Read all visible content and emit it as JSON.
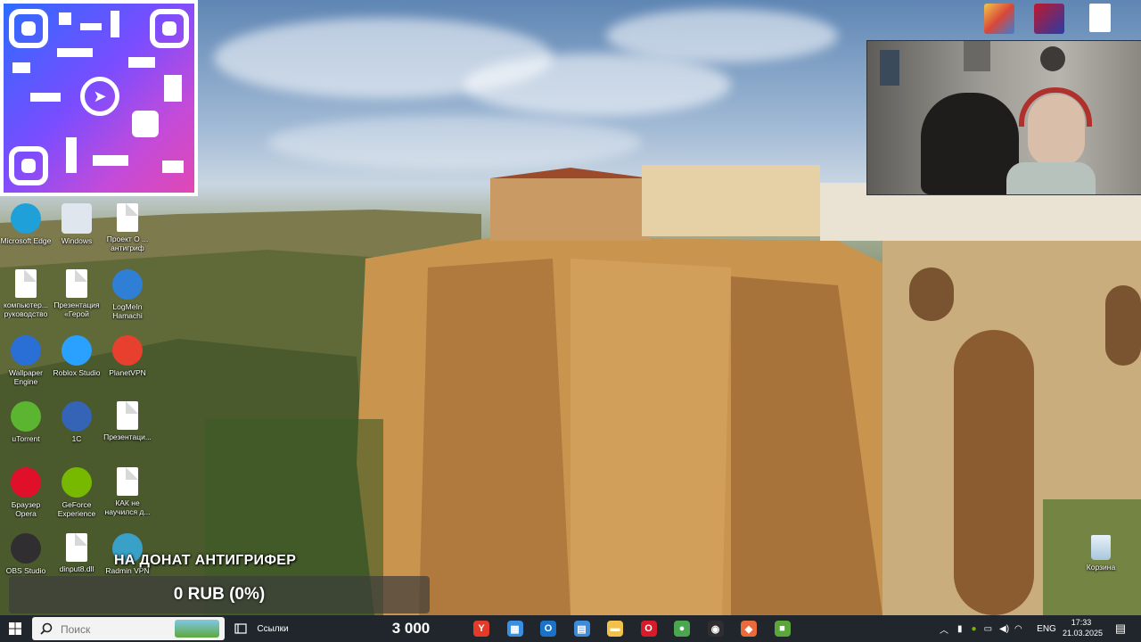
{
  "desktop": {
    "icons": [
      {
        "label": "Microsoft Edge",
        "kind": "edge",
        "color": "#1fa0d8"
      },
      {
        "label": "Windows",
        "kind": "win",
        "color": "#dfe6ee"
      },
      {
        "label": "Проект О ... антигриф",
        "kind": "doc",
        "color": "#ffffff"
      },
      {
        "label": "компьютер... руководство",
        "kind": "doc",
        "color": "#ffffff"
      },
      {
        "label": "Презентация «Герой",
        "kind": "doc",
        "color": "#ffffff"
      },
      {
        "label": "LogMeIn Hamachi",
        "kind": "app",
        "color": "#2f7fd6"
      },
      {
        "label": "Wallpaper Engine",
        "kind": "app",
        "color": "#2a6fd6"
      },
      {
        "label": "Roblox Studio",
        "kind": "app",
        "color": "#2aa0ff"
      },
      {
        "label": "PlanetVPN",
        "kind": "app",
        "color": "#e8402f"
      },
      {
        "label": "uTorrent",
        "kind": "app",
        "color": "#5cb531"
      },
      {
        "label": "1С",
        "kind": "app",
        "color": "#3563b5"
      },
      {
        "label": "Презентаци...",
        "kind": "doc",
        "color": "#ffffff"
      },
      {
        "label": "Браузер Opera",
        "kind": "app",
        "color": "#e0102a"
      },
      {
        "label": "GeForce Experience",
        "kind": "app",
        "color": "#76b900"
      },
      {
        "label": "КАК не научился д...",
        "kind": "doc",
        "color": "#ffffff"
      },
      {
        "label": "OBS Studio",
        "kind": "app",
        "color": "#302e31"
      },
      {
        "label": "dinput8.dll",
        "kind": "doc",
        "color": "#ffffff"
      },
      {
        "label": "Radmin VPN",
        "kind": "app",
        "color": "#39a0c8"
      }
    ],
    "recycle_bin": "Корзина"
  },
  "overlay": {
    "donate_title": "НА ДОНАТ АНТИГРИФЕР",
    "donate_value": "0 RUB (0%)"
  },
  "taskbar": {
    "search_placeholder": "Поиск",
    "links_label": "Ссылки",
    "counter": "3 000",
    "lang": "ENG",
    "time": "17:33",
    "date": "21.03.2025",
    "apps": [
      {
        "name": "yandex-browser-icon",
        "color": "#e23b2a",
        "glyph": "Y"
      },
      {
        "name": "store-icon",
        "color": "#3a8fe0",
        "glyph": "▦"
      },
      {
        "name": "outlook-icon",
        "color": "#1a73c9",
        "glyph": "O"
      },
      {
        "name": "calculator-icon",
        "color": "#3d8bdb",
        "glyph": "▤"
      },
      {
        "name": "file-explorer-icon",
        "color": "#f2c14b",
        "glyph": "▬"
      },
      {
        "name": "opera-icon",
        "color": "#d61b2b",
        "glyph": "O"
      },
      {
        "name": "chrome-icon",
        "color": "#4aa64f",
        "glyph": "●"
      },
      {
        "name": "obs-icon",
        "color": "#302e31",
        "glyph": "◉"
      },
      {
        "name": "wallpaper-engine-icon",
        "color": "#e96a3a",
        "glyph": "◆"
      },
      {
        "name": "minecraft-icon",
        "color": "#5aa63a",
        "glyph": "■"
      }
    ]
  }
}
